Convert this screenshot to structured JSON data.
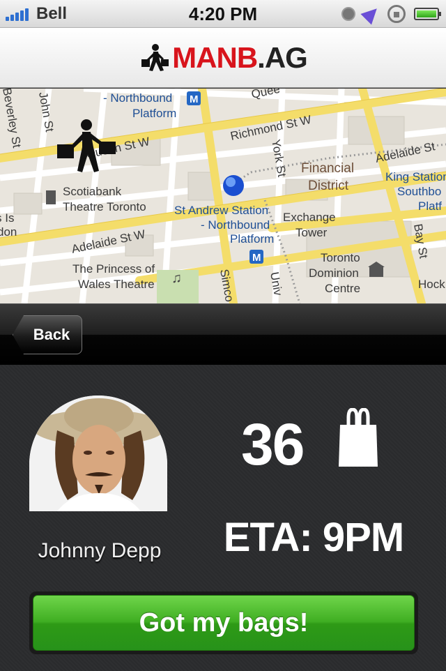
{
  "status_bar": {
    "carrier": "Bell",
    "time": "4:20 PM"
  },
  "header": {
    "logo_main": "MANB",
    "logo_suffix": ".AG"
  },
  "map": {
    "labels": {
      "northbound_platform_1": "- Northbound",
      "platform_1": "Platform",
      "queen": "Quee",
      "john_st": "John St",
      "beverley_st": "Beverley St",
      "richmond_st": "Richmond St W",
      "queen_st_w": "Queen St W",
      "york_st": "York St",
      "financial": "Financial",
      "district": "District",
      "adelaide_st_e": "Adelaide St",
      "king_station": "King Station",
      "southbound": "Southbo",
      "platf": "Platf",
      "scotiabank": "Scotiabank",
      "theatre_toronto": "Theatre Toronto",
      "st_andrew_station": "St Andrew Station",
      "northbound_2": "- Northbound",
      "platform_2": "Platform",
      "exchange": "Exchange",
      "tower": "Tower",
      "adelaide_st_w": "Adelaide St W",
      "bay_st": "Bay St",
      "is": "s Is",
      "don": "don",
      "princess": "The Princess of",
      "wales": "Wales Theatre",
      "simcoe": "Simco",
      "university": "Univ",
      "toronto": "Toronto",
      "dominion": "Dominion",
      "centre": "Centre",
      "hock": "Hock"
    }
  },
  "nav": {
    "back_label": "Back"
  },
  "delivery": {
    "name": "Johnny Depp",
    "bag_count": "36",
    "eta": "ETA: 9PM",
    "action_label": "Got my bags!"
  },
  "colors": {
    "logo_red": "#d8141c",
    "button_green": "#3fae22",
    "background": "#2a2b2d",
    "map_road": "#f7e27a"
  }
}
